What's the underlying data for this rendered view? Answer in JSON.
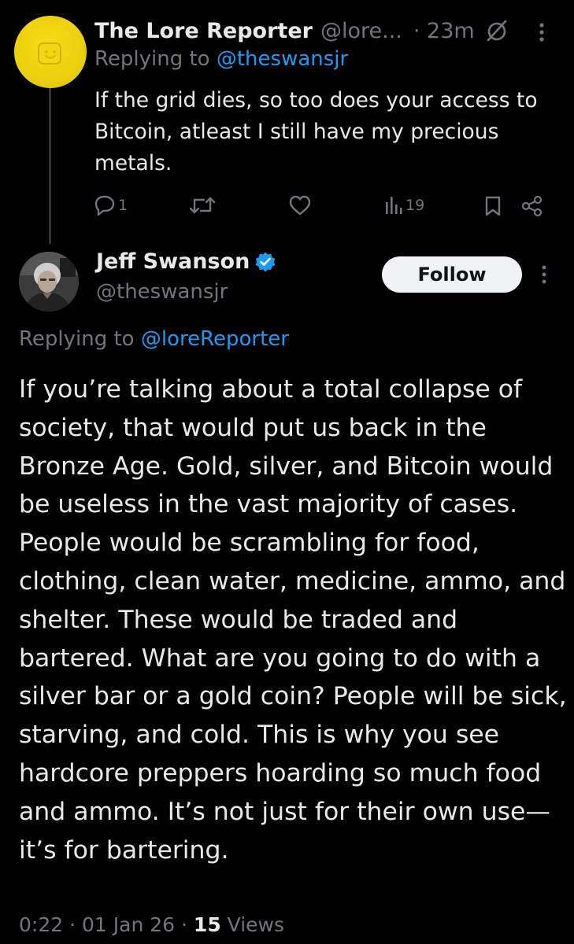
{
  "reply_tweet": {
    "author_name": "The Lore Reporter",
    "author_handle": "@lore...",
    "time": "· 23m",
    "replying_prefix": "Replying to ",
    "replying_handle": "@theswansjr",
    "text": "If the grid dies, so too does your access to Bitcoin, atleast I still have my precious metals.",
    "reply_count": "1",
    "views_count": "19",
    "icons": [
      "clock-slash-icon",
      "more-vertical-icon",
      "reply-icon",
      "retweet-icon",
      "like-icon",
      "views-icon",
      "bookmark-icon",
      "share-icon"
    ]
  },
  "main_tweet": {
    "author_name": "Jeff Swanson",
    "author_handle": "@theswansjr",
    "follow_label": "Follow",
    "replying_prefix": "Replying to ",
    "replying_handle": "@loreReporter",
    "text": "If you’re talking about a total collapse of society, that would put us back in the Bronze Age. Gold, silver, and Bitcoin would be useless in the vast majority of cases. People would be scrambling for food, clothing, clean water, medicine, ammo, and shelter. These would be traded and bartered. What are you going to do with a silver bar or a gold coin? People will be sick, starving, and cold. This is why you see hardcore preppers hoarding so much food and ammo. It’s not just for their own use—it’s for bartering.",
    "time": "0:22",
    "date": "01 Jan 26",
    "separator": "·",
    "views_count": "15",
    "views_label": "Views",
    "icons": [
      "verified-badge-icon",
      "more-vertical-icon"
    ]
  },
  "colors": {
    "background": "#000000",
    "text": "#e7e9ea",
    "muted": "#71767b",
    "link": "#1d9bf0",
    "thread_line": "#333639",
    "avatar_yellow": "#f1d713"
  }
}
